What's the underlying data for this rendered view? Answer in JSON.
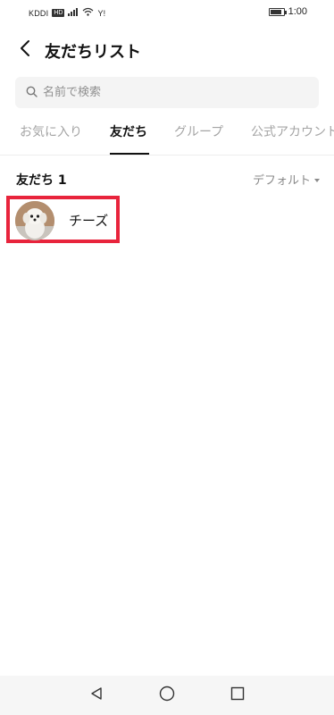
{
  "status_bar": {
    "carrier": "KDDI",
    "hd_badge": "HD",
    "network_label": "Y!",
    "time": "1:00",
    "battery_level": 0.75
  },
  "header": {
    "title": "友だちリスト",
    "back_icon": "chevron-left-icon"
  },
  "search": {
    "placeholder": "名前で検索",
    "value": "",
    "icon": "search-icon"
  },
  "tabs": [
    {
      "label": "お気に入り",
      "active": false
    },
    {
      "label": "友だち",
      "active": true
    },
    {
      "label": "グループ",
      "active": false
    },
    {
      "label": "公式アカウント",
      "active": false
    }
  ],
  "section": {
    "title": "友だち 1",
    "sort_label": "デフォルト"
  },
  "friends": [
    {
      "name": "チーズ",
      "avatar": "dog-photo-avatar"
    }
  ],
  "highlight_color": "#e8243c",
  "nav_bar": {
    "back_icon": "triangle-back-icon",
    "home_icon": "circle-home-icon",
    "recents_icon": "square-recents-icon"
  }
}
